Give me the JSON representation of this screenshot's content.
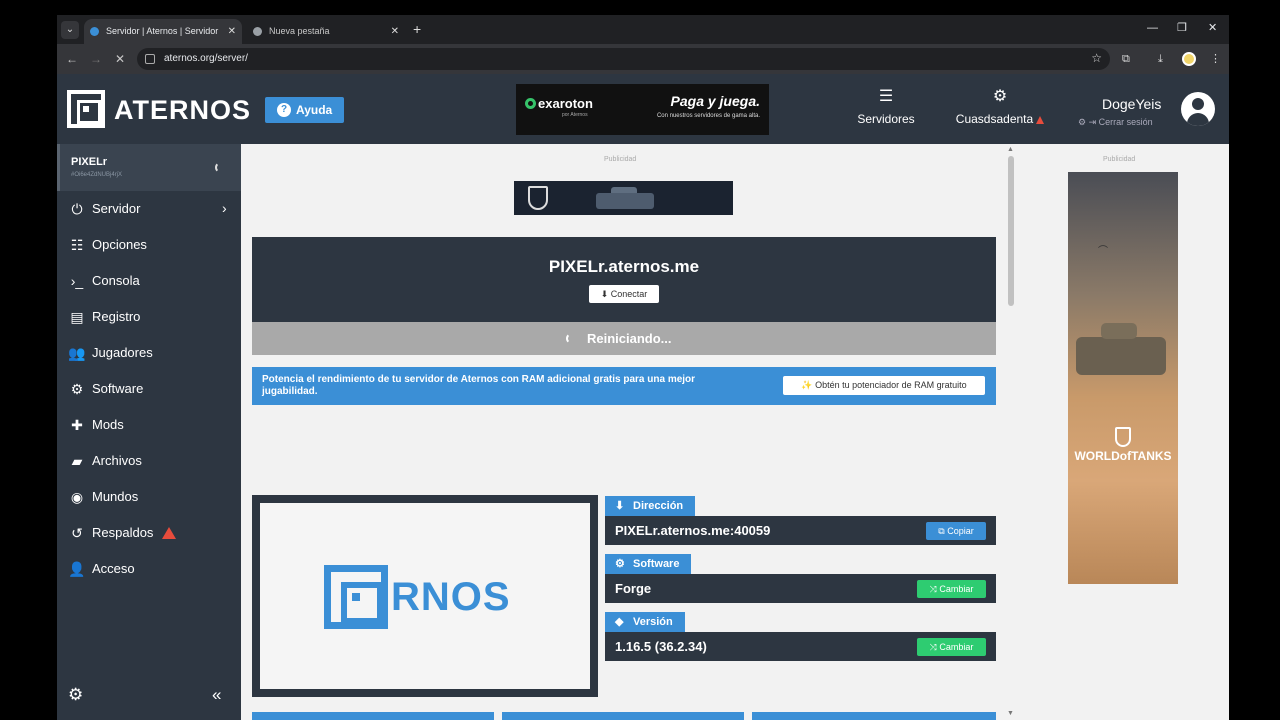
{
  "browser": {
    "tabs": [
      {
        "title": "Servidor | Aternos | Servidor de",
        "active": true
      },
      {
        "title": "Nueva pestaña",
        "active": false
      }
    ],
    "url": "aternos.org/server/"
  },
  "header": {
    "logo_text": "ATERNOS",
    "help_label": "Ayuda",
    "ad": {
      "brand": "exaroton",
      "brand_sub": "por Aternos",
      "headline": "Paga y juega.",
      "subline": "Con nuestros servidores de gama alta."
    },
    "nav": {
      "servers_label": "Servidores",
      "account_label": "Cuasdsadenta"
    },
    "user": {
      "name": "DogeYeis",
      "logout_label": "Cerrar sesión"
    }
  },
  "sidebar": {
    "server": {
      "name": "PIXELr",
      "id": "#Oi6e4ZdNUBj4rjX"
    },
    "items": [
      {
        "label": "Servidor",
        "icon": "power-icon"
      },
      {
        "label": "Opciones",
        "icon": "sliders-icon"
      },
      {
        "label": "Consola",
        "icon": "terminal-icon"
      },
      {
        "label": "Registro",
        "icon": "file-icon"
      },
      {
        "label": "Jugadores",
        "icon": "users-icon"
      },
      {
        "label": "Software",
        "icon": "gears-icon"
      },
      {
        "label": "Mods",
        "icon": "puzzle-icon"
      },
      {
        "label": "Archivos",
        "icon": "folder-icon"
      },
      {
        "label": "Mundos",
        "icon": "globe-icon"
      },
      {
        "label": "Respaldos",
        "icon": "history-icon"
      },
      {
        "label": "Acceso",
        "icon": "user-gear-icon"
      }
    ]
  },
  "main": {
    "ad_label": "Publicidad",
    "server_address": "PIXELr.aternos.me",
    "connect_label": "Conectar",
    "status_text": "Reiniciando...",
    "ram_banner": {
      "text": "Potencia el rendimiento de tu servidor de Aternos con RAM adicional gratis para una mejor jugabilidad.",
      "button": "Obtén tu potenciador de RAM gratuito"
    },
    "preview_logo_text": "RNOS",
    "info": {
      "address": {
        "tag": "Dirección",
        "value": "PIXELr.aternos.me:40059",
        "button": "Copiar"
      },
      "software": {
        "tag": "Software",
        "value": "Forge",
        "button": "Cambiar"
      },
      "version": {
        "tag": "Versión",
        "value": "1.16.5 (36.2.34)",
        "button": "Cambiar"
      }
    }
  },
  "right_ad": {
    "label": "Publicidad",
    "title": "WORLDofTANKS"
  },
  "colors": {
    "header": "#2d3641",
    "accent": "#3b8fd6",
    "success": "#2ecc71",
    "warning": "#e74c3c"
  }
}
